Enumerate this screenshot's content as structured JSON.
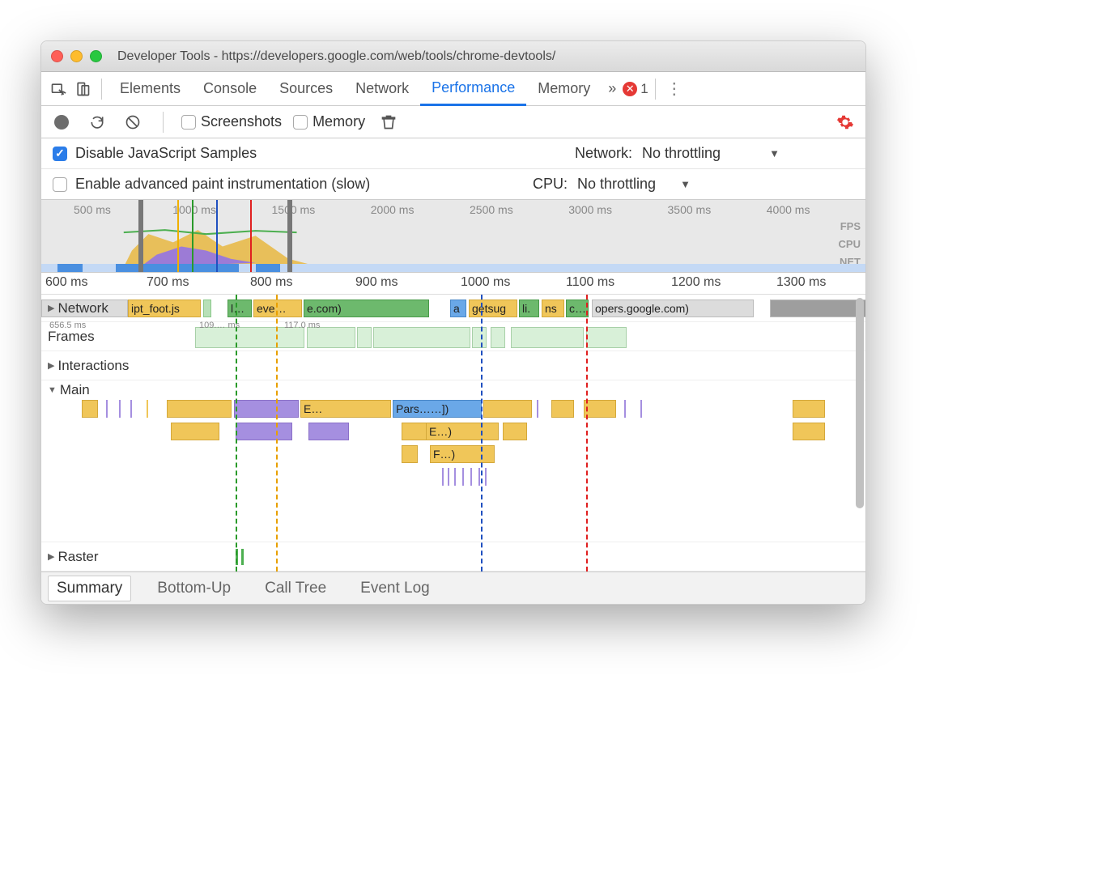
{
  "window": {
    "title": "Developer Tools - https://developers.google.com/web/tools/chrome-devtools/"
  },
  "tabs": {
    "items": [
      "Elements",
      "Console",
      "Sources",
      "Network",
      "Performance",
      "Memory"
    ],
    "more": "»",
    "error_count": "1"
  },
  "toolbar": {
    "screenshots": "Screenshots",
    "memory": "Memory"
  },
  "options": {
    "disable_js": "Disable JavaScript Samples",
    "advanced_paint": "Enable advanced paint instrumentation (slow)",
    "network_label": "Network:",
    "network_value": "No throttling",
    "cpu_label": "CPU:",
    "cpu_value": "No throttling"
  },
  "overview": {
    "ticks": [
      "500 ms",
      "1000 ms",
      "1500 ms",
      "2000 ms",
      "2500 ms",
      "3000 ms",
      "3500 ms",
      "4000 ms"
    ],
    "labels": [
      "FPS",
      "CPU",
      "NET"
    ]
  },
  "ruler": {
    "ticks": [
      "600 ms",
      "700 ms",
      "800 ms",
      "900 ms",
      "1000 ms",
      "1100 ms",
      "1200 ms",
      "1300 ms"
    ]
  },
  "tracks": {
    "network": {
      "label": "Network",
      "items": [
        "ipt_foot.js",
        "l…",
        "eve…",
        "e.com)",
        "a",
        "getsug",
        "li.",
        "ns",
        "c…",
        "opers.google.com)"
      ]
    },
    "frames": {
      "label": "Frames",
      "t0": "656.5 ms",
      "f1": "109.… ms",
      "f2": "117.0 ms"
    },
    "interactions": {
      "label": "Interactions"
    },
    "main": {
      "label": "Main",
      "e": "E…",
      "parse": "Pars……])",
      "e2": "E…)",
      "f": "F…)"
    },
    "raster": {
      "label": "Raster"
    }
  },
  "bottom": {
    "tabs": [
      "Summary",
      "Bottom-Up",
      "Call Tree",
      "Event Log"
    ]
  }
}
